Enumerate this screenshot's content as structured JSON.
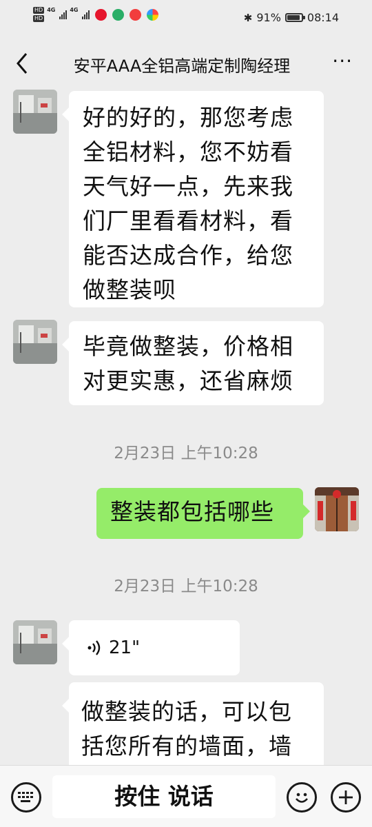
{
  "status_bar": {
    "hd1": "HD",
    "hd2": "HD",
    "net1": "4G",
    "net2": "4G",
    "battery_percent": "91%",
    "battery_level": 0.91,
    "time": "08:14",
    "icons": [
      "weibo-icon",
      "wechat-icon",
      "location-app-icon",
      "colorful-app-icon",
      "bluetooth-icon"
    ]
  },
  "header": {
    "title": "安平AAA全铝高端定制陶经理",
    "back_icon": "chevron-left-icon",
    "more_label": "···"
  },
  "messages": [
    {
      "side": "in",
      "text": "好的好的，那您考虑全铝材料，您不妨看天气好一点，先来我们厂里看看材料，看能否达成合作，给您做整装呗"
    },
    {
      "side": "in",
      "text": "毕竟做整装，价格相对更实惠，还省麻烦"
    },
    {
      "type": "timestamp",
      "text": "2月23日 上午10:28"
    },
    {
      "side": "out",
      "text": "整装都包括哪些"
    },
    {
      "type": "timestamp",
      "text": "2月23日 上午10:28"
    },
    {
      "side": "in",
      "type": "voice",
      "duration": "21\""
    },
    {
      "side": "in",
      "text": "做整装的话，可以包括您所有的墙面，墙面等活，背景墙装饰"
    }
  ],
  "bottom_bar": {
    "keyboard_icon": "keyboard-icon",
    "talk_label": "按住 说话",
    "emoji_icon": "emoji-icon",
    "plus_icon": "plus-icon"
  },
  "colors": {
    "background": "#ededed",
    "incoming_bubble": "#ffffff",
    "outgoing_bubble": "#95ec69",
    "timestamp": "#8a8a8a"
  }
}
